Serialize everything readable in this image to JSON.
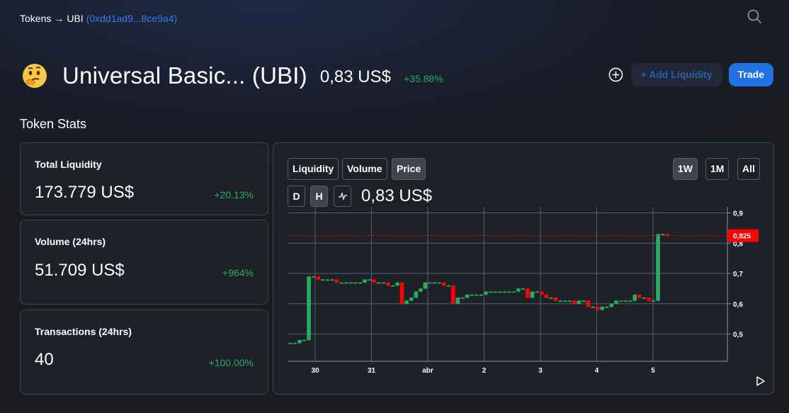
{
  "breadcrumb": {
    "root": "Tokens",
    "arrow": "→",
    "token": "UBI",
    "address": "(0xdd1ad9...8ce9a4)"
  },
  "token": {
    "name": "Universal Basic... (UBI)",
    "price": "0,83 US$",
    "change": "+35.88%"
  },
  "actions": {
    "add_liquidity": "+ Add Liquidity",
    "trade": "Trade"
  },
  "stats": {
    "title": "Token Stats",
    "cards": [
      {
        "label": "Total Liquidity",
        "value": "173.779 US$",
        "change": "+20.13%"
      },
      {
        "label": "Volume (24hrs)",
        "value": "51.709 US$",
        "change": "+964%"
      },
      {
        "label": "Transactions (24hrs)",
        "value": "40",
        "change": "+100.00%"
      }
    ]
  },
  "chart": {
    "tabs": [
      "Liquidity",
      "Volume",
      "Price"
    ],
    "active_tab": "Price",
    "ranges": [
      "1W",
      "1M",
      "All"
    ],
    "active_range": "1W",
    "intervals": [
      "D",
      "H"
    ],
    "active_interval": "H",
    "current_price": "0,83 US$",
    "colors": {
      "up": "#27ae60",
      "down": "#ff0000",
      "marker": "#ff0000"
    }
  },
  "chart_data": {
    "type": "line",
    "title": "",
    "xlabel": "",
    "ylabel": "",
    "x_ticks": [
      "30",
      "31",
      "abr",
      "2",
      "3",
      "4",
      "5"
    ],
    "y_ticks": [
      "0,5",
      "0,6",
      "0,7",
      "0,8",
      "0,9"
    ],
    "ylim": [
      0.41,
      0.92
    ],
    "last_price_label": "0,825",
    "grid": true,
    "series": [
      {
        "values": [
          0.47,
          0.47,
          0.48,
          0.48,
          0.69,
          0.69,
          0.68,
          0.68,
          0.68,
          0.68,
          0.67,
          0.67,
          0.67,
          0.67,
          0.67,
          0.67,
          0.68,
          0.68,
          0.67,
          0.67,
          0.67,
          0.66,
          0.66,
          0.67,
          0.6,
          0.61,
          0.62,
          0.64,
          0.65,
          0.67,
          0.67,
          0.67,
          0.67,
          0.66,
          0.66,
          0.6,
          0.62,
          0.62,
          0.63,
          0.63,
          0.63,
          0.63,
          0.64,
          0.64,
          0.64,
          0.64,
          0.64,
          0.64,
          0.64,
          0.65,
          0.65,
          0.62,
          0.64,
          0.64,
          0.63,
          0.62,
          0.62,
          0.61,
          0.61,
          0.61,
          0.61,
          0.6,
          0.61,
          0.61,
          0.59,
          0.59,
          0.58,
          0.59,
          0.59,
          0.6,
          0.61,
          0.61,
          0.61,
          0.61,
          0.63,
          0.62,
          0.62,
          0.61,
          0.61,
          0.83,
          0.83,
          0.825
        ]
      }
    ]
  }
}
